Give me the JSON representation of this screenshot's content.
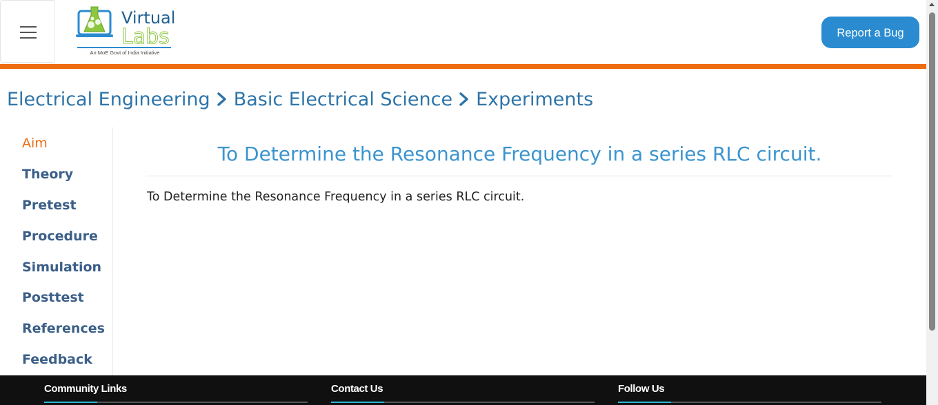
{
  "header": {
    "menu_icon": "hamburger-menu-icon",
    "logo": {
      "word1": "Virtual",
      "word2": "Labs",
      "tagline": "An MoE Govt of India Initiative"
    },
    "report_bug_label": "Report a Bug"
  },
  "breadcrumb": [
    "Electrical Engineering",
    "Basic Electrical Science",
    "Experiments"
  ],
  "sidebar": {
    "items": [
      {
        "label": "Aim",
        "active": true
      },
      {
        "label": "Theory",
        "active": false
      },
      {
        "label": "Pretest",
        "active": false
      },
      {
        "label": "Procedure",
        "active": false
      },
      {
        "label": "Simulation",
        "active": false
      },
      {
        "label": "Posttest",
        "active": false
      },
      {
        "label": "References",
        "active": false
      },
      {
        "label": "Feedback",
        "active": false
      }
    ]
  },
  "main": {
    "title": "To Determine the Resonance Frequency in a series RLC circuit.",
    "body": "To Determine the Resonance Frequency in a series RLC circuit."
  },
  "footer": {
    "columns": [
      "Community Links",
      "Contact Us",
      "Follow Us"
    ]
  },
  "colors": {
    "accent_orange": "#ee6b10",
    "brand_blue": "#2a8bd0",
    "title_blue": "#3b94cf",
    "link_blue": "#2d74a8",
    "footer_bg": "#101010",
    "footer_accent": "#2fb6d7"
  }
}
